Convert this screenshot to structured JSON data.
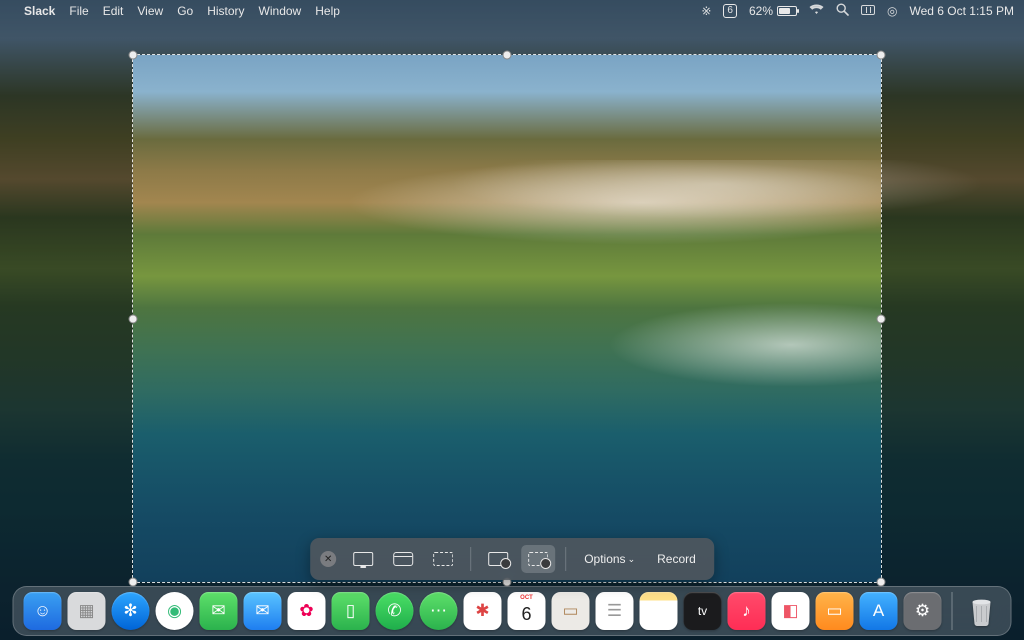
{
  "menubar": {
    "app_name": "Slack",
    "items": [
      "File",
      "Edit",
      "View",
      "Go",
      "History",
      "Window",
      "Help"
    ],
    "battery_pct": "62%",
    "box_number": "6",
    "datetime": "Wed 6 Oct  1:15 PM"
  },
  "screenshot_bar": {
    "options_label": "Options",
    "record_label": "Record"
  },
  "dock": {
    "apps": [
      {
        "name": "finder",
        "bg": "linear-gradient(#3aa0f2,#1e6ae0)",
        "glyph": "☺"
      },
      {
        "name": "launchpad",
        "bg": "#d9dadc",
        "glyph": "▦",
        "color": "#888"
      },
      {
        "name": "safari",
        "bg": "linear-gradient(#2ea6ff,#0064d6)",
        "glyph": "✻",
        "round": true
      },
      {
        "name": "chrome",
        "bg": "#fff",
        "glyph": "◉",
        "color": "#3b7",
        "round": true
      },
      {
        "name": "messages",
        "bg": "linear-gradient(#5ee06a,#2bb24d)",
        "glyph": "✉"
      },
      {
        "name": "mail",
        "bg": "linear-gradient(#5ac4ff,#1e7ef0)",
        "glyph": "✉"
      },
      {
        "name": "photos",
        "bg": "#fff",
        "glyph": "✿",
        "color": "#e05"
      },
      {
        "name": "facetime",
        "bg": "linear-gradient(#5ee06a,#2bb24d)",
        "glyph": "▯"
      },
      {
        "name": "whatsapp",
        "bg": "linear-gradient(#4be066,#1fae4b)",
        "glyph": "✆",
        "round": true
      },
      {
        "name": "sms",
        "bg": "linear-gradient(#5ee06a,#2bb24d)",
        "glyph": "⋯",
        "round": true
      },
      {
        "name": "slack",
        "bg": "#fff",
        "glyph": "✱",
        "color": "#d44"
      },
      {
        "name": "calendar",
        "bg": "#fff",
        "glyph": "6",
        "color": "#222"
      },
      {
        "name": "contacts",
        "bg": "#eceae6",
        "glyph": "▭",
        "color": "#b0885c"
      },
      {
        "name": "reminders",
        "bg": "#fff",
        "glyph": "☰",
        "color": "#999"
      },
      {
        "name": "notes",
        "bg": "linear-gradient(#ffe08a 22%, #fff 22%)",
        "glyph": "",
        "color": "#555"
      },
      {
        "name": "appletv",
        "bg": "#1b1b1d",
        "glyph": "tv",
        "fs": 12
      },
      {
        "name": "music",
        "bg": "linear-gradient(#ff4b6b,#ff2d55)",
        "glyph": "♪"
      },
      {
        "name": "todo",
        "bg": "#fff",
        "glyph": "◧",
        "color": "#e56"
      },
      {
        "name": "keynote",
        "bg": "linear-gradient(#ffb44a,#ff8a1e)",
        "glyph": "▭"
      },
      {
        "name": "appstore",
        "bg": "linear-gradient(#44b2ff,#1277e6)",
        "glyph": "A"
      },
      {
        "name": "settings",
        "bg": "#6b6d71",
        "glyph": "⚙"
      }
    ]
  }
}
